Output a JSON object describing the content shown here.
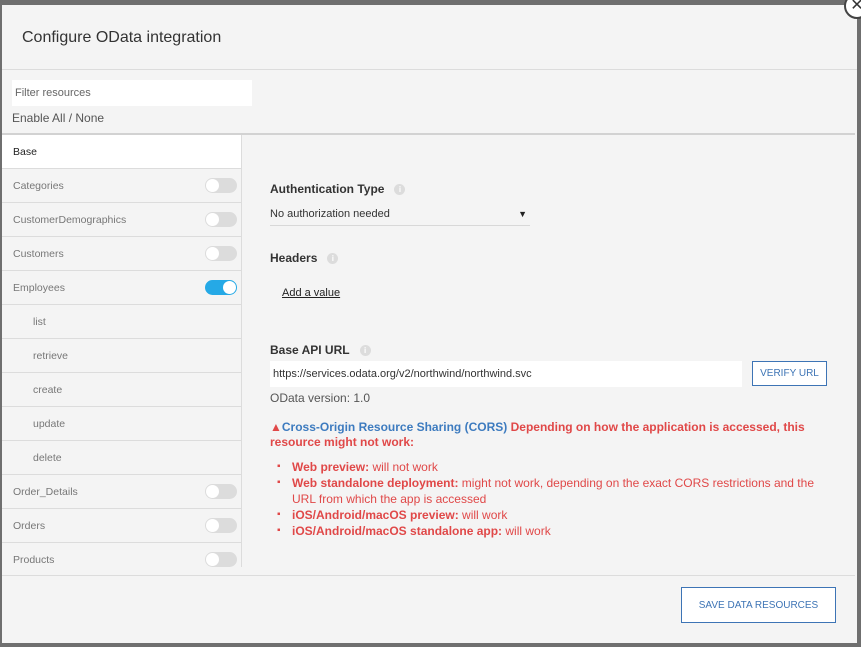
{
  "modal": {
    "title": "Configure OData integration",
    "close_glyph": "✕"
  },
  "filter": {
    "placeholder": "Filter resources",
    "value": "",
    "enable_all_label": "Enable All / None"
  },
  "sidebar": {
    "items": [
      {
        "label": "Base",
        "name": "sidebar-item-base",
        "active": true,
        "sub": false,
        "toggle": null
      },
      {
        "label": "Categories",
        "name": "sidebar-item-categories",
        "active": false,
        "sub": false,
        "toggle": "off"
      },
      {
        "label": "CustomerDemographics",
        "name": "sidebar-item-customerdemographics",
        "active": false,
        "sub": false,
        "toggle": "off"
      },
      {
        "label": "Customers",
        "name": "sidebar-item-customers",
        "active": false,
        "sub": false,
        "toggle": "off"
      },
      {
        "label": "Employees",
        "name": "sidebar-item-employees",
        "active": false,
        "sub": false,
        "toggle": "on"
      },
      {
        "label": "list",
        "name": "sidebar-subitem-list",
        "active": false,
        "sub": true,
        "toggle": null
      },
      {
        "label": "retrieve",
        "name": "sidebar-subitem-retrieve",
        "active": false,
        "sub": true,
        "toggle": null
      },
      {
        "label": "create",
        "name": "sidebar-subitem-create",
        "active": false,
        "sub": true,
        "toggle": null
      },
      {
        "label": "update",
        "name": "sidebar-subitem-update",
        "active": false,
        "sub": true,
        "toggle": null
      },
      {
        "label": "delete",
        "name": "sidebar-subitem-delete",
        "active": false,
        "sub": true,
        "toggle": null
      },
      {
        "label": "Order_Details",
        "name": "sidebar-item-order-details",
        "active": false,
        "sub": false,
        "toggle": "off"
      },
      {
        "label": "Orders",
        "name": "sidebar-item-orders",
        "active": false,
        "sub": false,
        "toggle": "off"
      },
      {
        "label": "Products",
        "name": "sidebar-item-products",
        "active": false,
        "sub": false,
        "toggle": "off"
      }
    ]
  },
  "auth": {
    "label": "Authentication Type",
    "selected": "No authorization needed"
  },
  "headers": {
    "label": "Headers",
    "add_value_label": "Add a value"
  },
  "base_url": {
    "label": "Base API URL",
    "value": "https://services.odata.org/v2/northwind/northwind.svc",
    "verify_label": "VERIFY URL",
    "version_text": "OData version: 1.0"
  },
  "cors": {
    "link_text": "Cross-Origin Resource Sharing (CORS)",
    "message": " Depending on how the application is accessed, this resource might not work:",
    "items": [
      {
        "title": "Web preview:",
        "text": " will not work"
      },
      {
        "title": "Web standalone deployment:",
        "text": " might not work, depending on the exact CORS restrictions and the URL from which the app is accessed"
      },
      {
        "title": "iOS/Android/macOS preview:",
        "text": " will work"
      },
      {
        "title": "iOS/Android/macOS standalone app:",
        "text": " will work"
      }
    ]
  },
  "footer": {
    "save_label": "SAVE DATA RESOURCES"
  },
  "colors": {
    "accent": "#3d74b5",
    "toggle_on": "#25a9e6",
    "warning": "#e04848",
    "link": "#3d7bbf"
  }
}
